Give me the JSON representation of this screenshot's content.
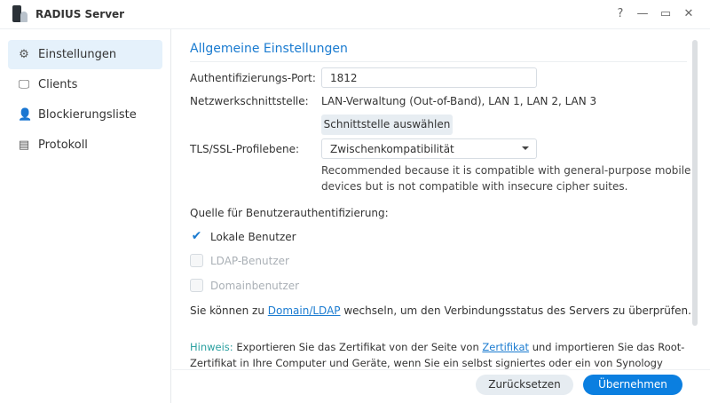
{
  "window": {
    "title": "RADIUS Server",
    "help": "?",
    "minimize": "—",
    "maximize": "▭",
    "close": "✕"
  },
  "sidebar": {
    "items": [
      {
        "label": "Einstellungen",
        "icon": "⚙"
      },
      {
        "label": "Clients",
        "icon": "🖵"
      },
      {
        "label": "Blockierungsliste",
        "icon": "👤"
      },
      {
        "label": "Protokoll",
        "icon": "▤"
      }
    ]
  },
  "main": {
    "heading": "Allgemeine Einstellungen",
    "port_label": "Authentifizierungs-Port:",
    "port_value": "1812",
    "nic_label": "Netzwerkschnittstelle:",
    "nic_value": "LAN-Verwaltung (Out-of-Band), LAN 1, LAN 2, LAN 3",
    "nic_button": "Schnittstelle auswählen",
    "tls_label": "TLS/SSL-Profilebene:",
    "tls_value": "Zwischenkompatibilität",
    "tls_note": "Recommended because it is compatible with general-purpose mobile devices but is not compatible with insecure cipher suites.",
    "source_label": "Quelle für Benutzerauthentifizierung:",
    "checkboxes": [
      {
        "label": "Lokale Benutzer",
        "checked": true
      },
      {
        "label": "LDAP-Benutzer",
        "checked": false
      },
      {
        "label": "Domainbenutzer",
        "checked": false
      }
    ],
    "domain_text_pre": "Sie können zu ",
    "domain_link": "Domain/LDAP",
    "domain_text_post": " wechseln, um den Verbindungsstatus des Servers zu überprüfen.",
    "hint_key": "Hinweis:",
    "hint_pre": " Exportieren Sie das Zertifikat von der Seite von ",
    "hint_link": "Zertifikat",
    "hint_post": " und importieren Sie das Root-Zertifikat in Ihre Computer und Geräte, wenn Sie ein selbst signiertes oder ein von Synology signiertes Zertifikat"
  },
  "footer": {
    "reset": "Zurücksetzen",
    "apply": "Übernehmen"
  }
}
